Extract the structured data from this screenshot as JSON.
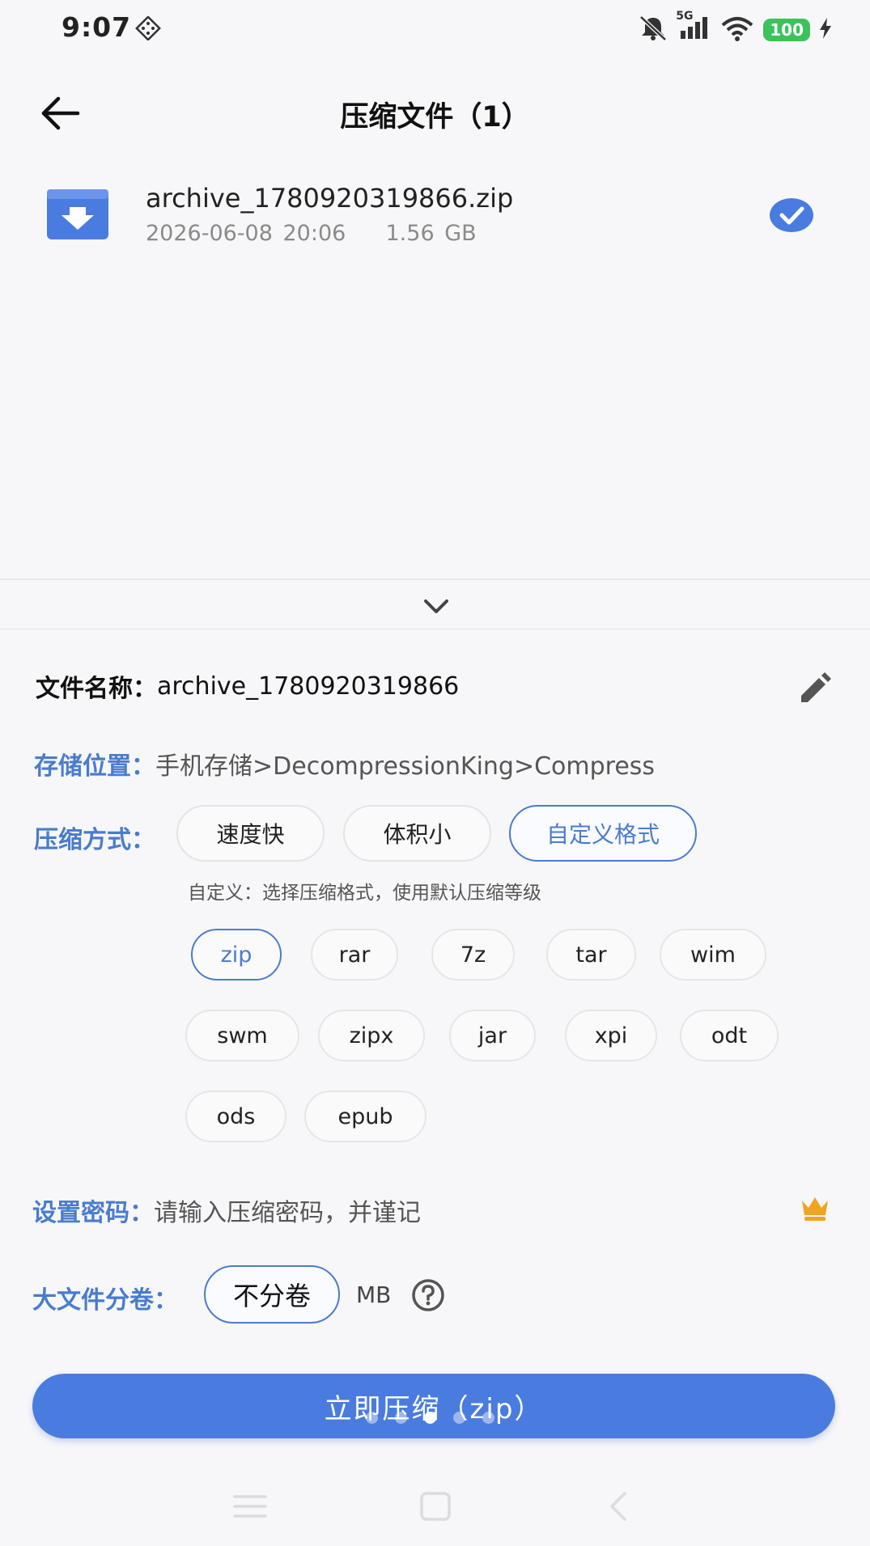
{
  "status_bar": {
    "time": "9:07",
    "network": "5G",
    "battery": "100",
    "icons": [
      "grid-dots-icon",
      "mute-bell-icon",
      "signal-icon",
      "wifi-icon",
      "battery-icon",
      "charging-icon"
    ]
  },
  "header": {
    "title": "压缩文件（1）",
    "back_icon": "arrow-left-icon"
  },
  "file": {
    "name": "archive_1780920319866.zip",
    "date": "2026-06-08 20:06",
    "size": "1.56 GB",
    "icon": "archive-folder-icon",
    "selected": true
  },
  "sheet": {
    "collapse_icon": "chevron-down-icon",
    "file_name_label": "文件名称：",
    "file_name_value": "archive_1780920319866",
    "storage_label": "存储位置：",
    "storage_value": "手机存储>DecompressionKing>Compress",
    "method_label": "压缩方式：",
    "methods": [
      "速度快",
      "体积小",
      "自定义格式"
    ],
    "method_selected": "自定义格式",
    "hint": "自定义：选择压缩格式，使用默认压缩等级",
    "formats": [
      "zip",
      "rar",
      "7z",
      "tar",
      "wim",
      "swm",
      "zipx",
      "jar",
      "xpi",
      "odt",
      "ods",
      "epub"
    ],
    "format_selected": "zip",
    "password_label": "设置密码：",
    "password_placeholder": "请输入压缩密码，并谨记",
    "split_label": "大文件分卷：",
    "split_value": "不分卷",
    "split_unit": "MB",
    "compress_button": "立即压缩（zip）"
  },
  "colors": {
    "accent": "#4a7ccd",
    "button": "#4a7ce0",
    "crown": "#f0a420",
    "battery": "#3cc25a"
  }
}
